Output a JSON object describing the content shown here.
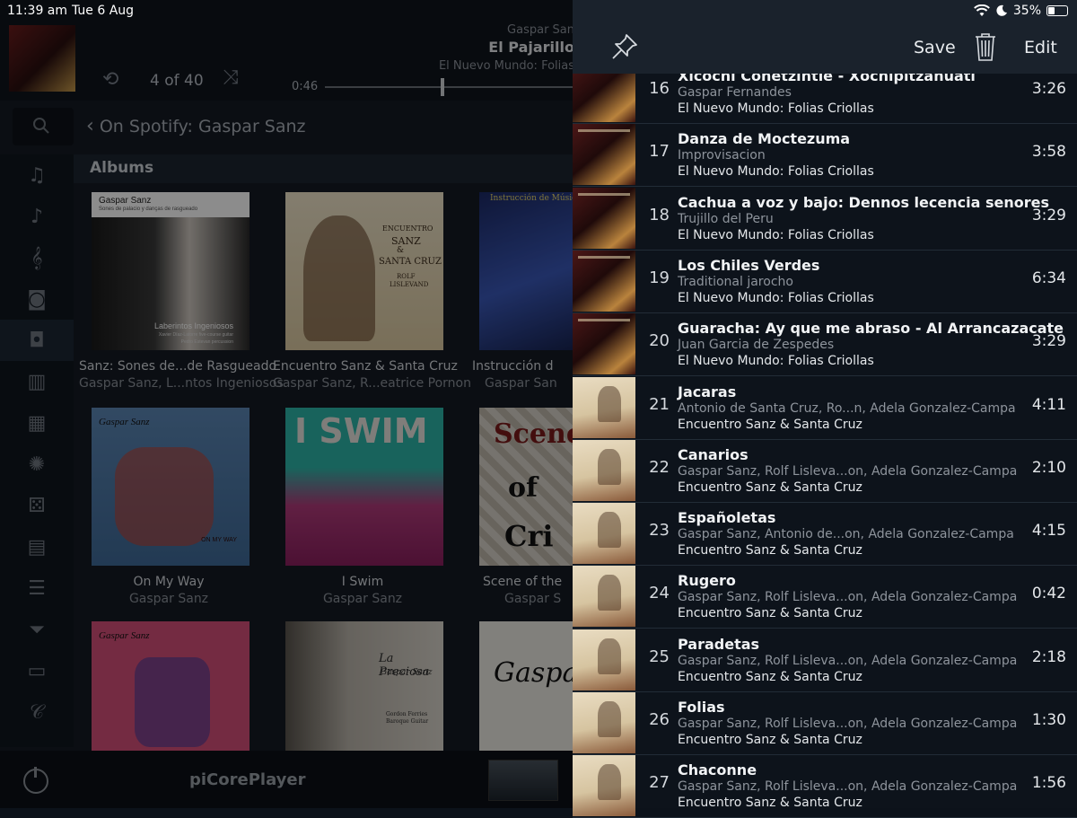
{
  "status": {
    "time": "11:39 am",
    "date": "Tue 6 Aug",
    "battery": "35%"
  },
  "now_playing": {
    "count": "4 of 40",
    "artist": "Gaspar San",
    "track": "El Pajarillo",
    "album": "El Nuevo Mundo: Folias",
    "elapsed": "0:46",
    "progress_fraction": 0.47
  },
  "breadcrumb": "On Spotify: Gaspar Sanz",
  "section_title": "Albums",
  "albums": [
    {
      "name": "Sanz: Sones de...de Rasgueado",
      "artist": "Gaspar Sanz, L...ntos Ingeniosos",
      "cover_text": [
        "Gaspar Sanz",
        "Sones de palacio y danças de rasgueado",
        "Laberintos Ingeniosos",
        "Xavier Díaz-Latorre five-course guitar",
        "Pedro Estevan percussion"
      ]
    },
    {
      "name": "Encuentro Sanz & Santa Cruz",
      "artist": "Gaspar Sanz, R...eatrice Pornon",
      "cover_text": [
        "ENCUENTRO",
        "SANZ",
        "&",
        "SANTA CRUZ",
        "ROLF",
        "LISLEVAND"
      ]
    },
    {
      "name": "Instrucción d",
      "artist": "Gaspar San",
      "cover_text": [
        "Instrucción de Música"
      ]
    },
    {
      "name": "On My Way",
      "artist": "Gaspar Sanz",
      "cover_text": [
        "Gaspar Sanz",
        "ON MY WAY"
      ]
    },
    {
      "name": "I Swim",
      "artist": "Gaspar Sanz",
      "cover_text": [
        "I SWIM"
      ]
    },
    {
      "name": "Scene of the",
      "artist": "Gaspar S",
      "cover_text": [
        "Scene",
        "of",
        "Cri"
      ]
    },
    {
      "name": "",
      "artist": "",
      "cover_text": [
        "Gaspar Sanz"
      ]
    },
    {
      "name": "",
      "artist": "",
      "cover_text": [
        "La Preciosa",
        "Gaspar Sanz",
        "Gordon Ferries",
        "Baroque Guitar"
      ]
    },
    {
      "name": "",
      "artist": "",
      "cover_text": [
        "Gaspar S"
      ]
    }
  ],
  "bottom": {
    "player_name": "piCorePlayer"
  },
  "queue_header": {
    "save": "Save",
    "edit": "Edit"
  },
  "queue": [
    {
      "num": "16",
      "title": "Xicochi Conetzintle - Xochipitzahuatl",
      "artist": "Gaspar Fernandes",
      "album": "El Nuevo Mundo: Folias Criollas",
      "duration": "3:26",
      "art": "nm"
    },
    {
      "num": "17",
      "title": "Danza de Moctezuma",
      "artist": "Improvisacion",
      "album": "El Nuevo Mundo: Folias Criollas",
      "duration": "3:58",
      "art": "nm"
    },
    {
      "num": "18",
      "title": "Cachua a voz y bajo: Dennos lecencia senores",
      "artist": "Trujillo del Peru",
      "album": "El Nuevo Mundo: Folias Criollas",
      "duration": "3:29",
      "art": "nm"
    },
    {
      "num": "19",
      "title": "Los Chiles Verdes",
      "artist": "Traditional jarocho",
      "album": "El Nuevo Mundo: Folias Criollas",
      "duration": "6:34",
      "art": "nm"
    },
    {
      "num": "20",
      "title": "Guaracha: Ay que me abraso - Al Arrancazacate",
      "artist": "Juan Garcia de Zespedes",
      "album": "El Nuevo Mundo: Folias Criollas",
      "duration": "3:29",
      "art": "nm"
    },
    {
      "num": "21",
      "title": "Jacaras",
      "artist": "Antonio de Santa Cruz, Ro...n, Adela Gonzalez-Campa",
      "album": "Encuentro Sanz & Santa Cruz",
      "duration": "4:11",
      "art": "sz"
    },
    {
      "num": "22",
      "title": "Canarios",
      "artist": "Gaspar Sanz, Rolf Lisleva...on, Adela Gonzalez-Campa",
      "album": "Encuentro Sanz & Santa Cruz",
      "duration": "2:10",
      "art": "sz"
    },
    {
      "num": "23",
      "title": "Españoletas",
      "artist": "Gaspar Sanz, Antonio de...on, Adela Gonzalez-Campa",
      "album": "Encuentro Sanz & Santa Cruz",
      "duration": "4:15",
      "art": "sz"
    },
    {
      "num": "24",
      "title": "Rugero",
      "artist": "Gaspar Sanz, Rolf Lisleva...on, Adela Gonzalez-Campa",
      "album": "Encuentro Sanz & Santa Cruz",
      "duration": "0:42",
      "art": "sz"
    },
    {
      "num": "25",
      "title": "Paradetas",
      "artist": "Gaspar Sanz, Rolf Lisleva...on, Adela Gonzalez-Campa",
      "album": "Encuentro Sanz & Santa Cruz",
      "duration": "2:18",
      "art": "sz"
    },
    {
      "num": "26",
      "title": "Folias",
      "artist": "Gaspar Sanz, Rolf Lisleva...on, Adela Gonzalez-Campa",
      "album": "Encuentro Sanz & Santa Cruz",
      "duration": "1:30",
      "art": "sz"
    },
    {
      "num": "27",
      "title": "Chaconne",
      "artist": "Gaspar Sanz, Rolf Lisleva...on, Adela Gonzalez-Campa",
      "album": "Encuentro Sanz & Santa Cruz",
      "duration": "1:56",
      "art": "sz"
    }
  ]
}
